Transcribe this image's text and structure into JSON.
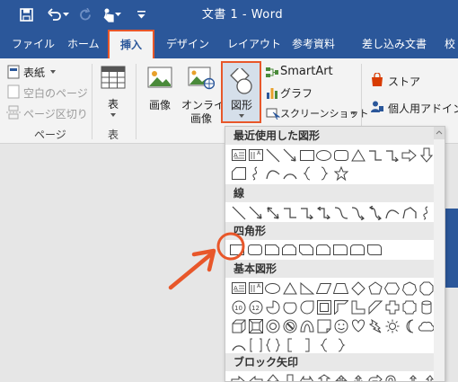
{
  "titlebar": {
    "doc_title": "文書 1 - Word",
    "qat": [
      "save-icon",
      "undo-icon",
      "redo-icon",
      "touch-mode-icon",
      "customize-qat-icon"
    ]
  },
  "tabs": [
    "ファイル",
    "ホーム",
    "挿入",
    "デザイン",
    "レイアウト",
    "参考資料",
    "差し込み文書",
    "校"
  ],
  "ribbon": {
    "pages": {
      "cover": "表紙",
      "blank": "空白のページ",
      "break": "ページ区切り",
      "group": "ページ"
    },
    "table": {
      "label": "表",
      "group": "表"
    },
    "illustrations": {
      "pictures": "画像",
      "online_pictures_1": "オンライン",
      "online_pictures_2": "画像",
      "shapes": "図形",
      "smartart": "SmartArt",
      "chart": "グラフ",
      "screenshot": "スクリーンショット"
    },
    "addins": {
      "store": "ストア",
      "my_addins": "個人用アドイン"
    }
  },
  "dropdown": {
    "sections": [
      "最近使用した図形",
      "線",
      "四角形",
      "基本図形",
      "ブロック矢印"
    ],
    "rect_selected_index": 0
  },
  "colors": {
    "brand": "#2b579a",
    "highlight": "#e8572a",
    "ribbon_bg": "#f3f3f3"
  }
}
